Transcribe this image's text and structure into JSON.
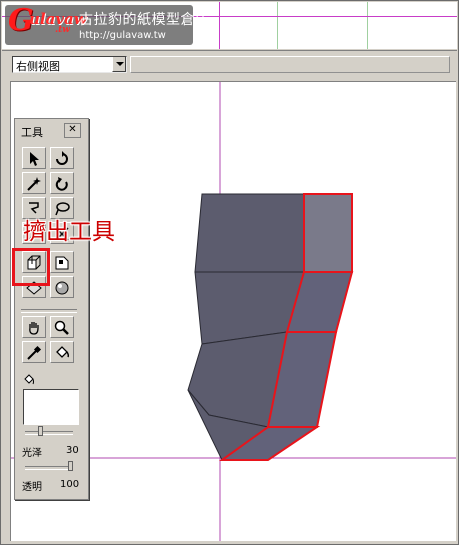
{
  "watermark": {
    "logo_letter": "G",
    "brand": "ulavaw",
    "brand_suffix": ".tw",
    "site_name": "古拉豹的紙模型倉庫",
    "url": "http://gulavaw.tw"
  },
  "view_select": {
    "value": "右侧视图"
  },
  "palette": {
    "title": "工具",
    "close_glyph": "✕",
    "tools": [
      {
        "name": "select-arrow-icon"
      },
      {
        "name": "rotate-icon"
      },
      {
        "name": "magic-wand-icon"
      },
      {
        "name": "spin-icon"
      },
      {
        "name": "lasso-poly-icon"
      },
      {
        "name": "lasso-icon"
      },
      {
        "name": "knife-icon"
      },
      {
        "name": "cut-icon"
      },
      {
        "name": "extrude-tool-icon"
      },
      {
        "name": "bevel-tool-icon"
      },
      {
        "name": "plane-tool-icon"
      },
      {
        "name": "sphere-tool-icon"
      },
      {
        "name": "hand-pan-icon"
      },
      {
        "name": "zoom-icon"
      },
      {
        "name": "eyedropper-icon"
      },
      {
        "name": "paint-bucket-icon"
      }
    ],
    "gloss_label": "光泽",
    "gloss_value": "30",
    "gloss_level": 0.3,
    "opacity_label": "透明",
    "opacity_value": "100",
    "opacity_level": 1.0
  },
  "annotation": {
    "text": "擠出工具",
    "color": "#cc0000"
  },
  "colors": {
    "model_face": "#5c5c6e",
    "model_face_selected": "#7a7a8a",
    "selection_edge": "#e8141b",
    "axis_line": "#b04ab0"
  }
}
